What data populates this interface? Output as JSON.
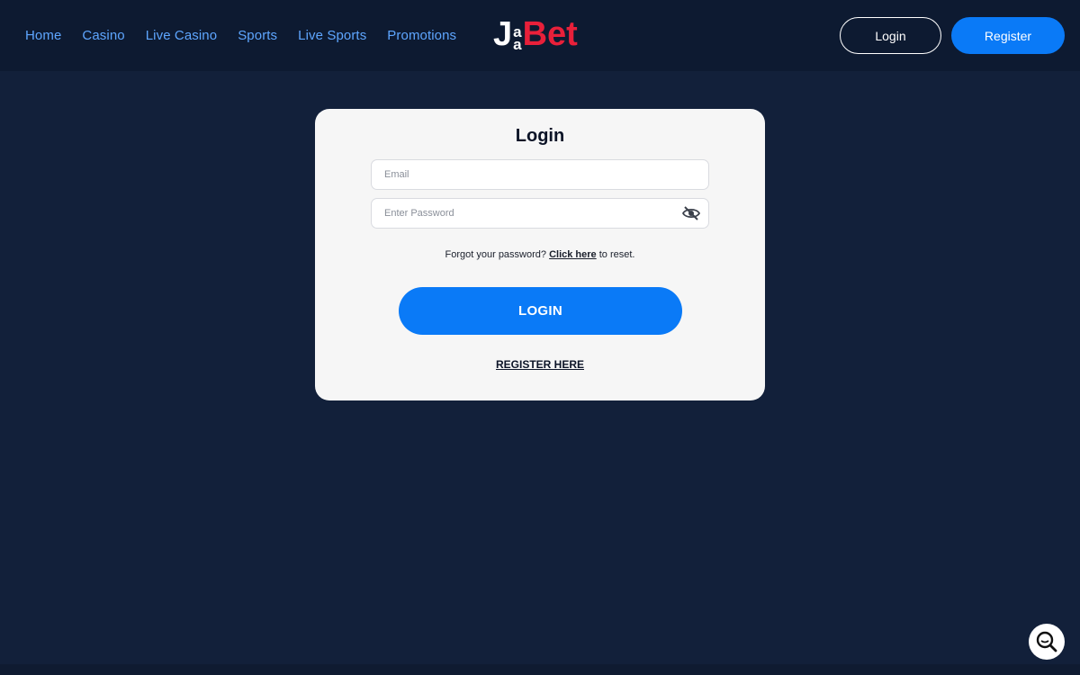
{
  "nav": {
    "items": [
      "Home",
      "Casino",
      "Live Casino",
      "Sports",
      "Live Sports",
      "Promotions"
    ]
  },
  "logo": {
    "text": "JaaBet"
  },
  "header": {
    "login_label": "Login",
    "register_label": "Register"
  },
  "login_form": {
    "title": "Login",
    "email_placeholder": "Email",
    "email_value": "",
    "password_placeholder": "Enter Password",
    "password_value": "",
    "forgot_prefix": "Forgot your password?",
    "forgot_link": "Click here",
    "forgot_suffix": "to reset.",
    "submit_label": "LOGIN",
    "register_link": "REGISTER HERE"
  },
  "icons": {
    "password_toggle": "eye-off-icon",
    "search_fab": "search-icon"
  },
  "colors": {
    "page_bg": "#12203a",
    "header_bg": "#0d1a31",
    "nav_link": "#5ea6ff",
    "primary": "#0a7af7",
    "logo_accent": "#e8203a"
  }
}
